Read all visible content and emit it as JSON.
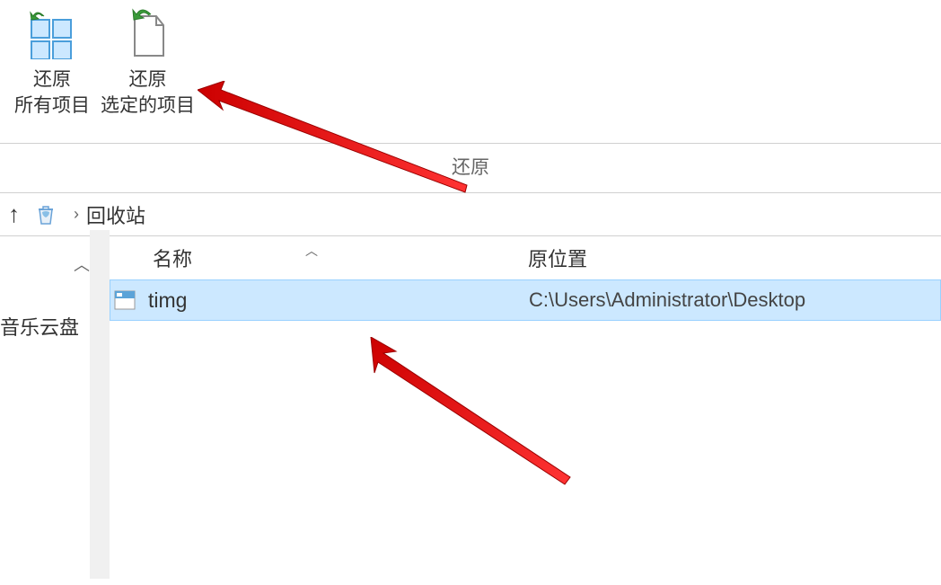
{
  "ribbon": {
    "restore_all": {
      "label_line1": "还原",
      "label_line2": "所有项目"
    },
    "restore_selected": {
      "label_line1": "还原",
      "label_line2": "选定的项目"
    },
    "group_label": "还原"
  },
  "breadcrumb": {
    "location": "回收站"
  },
  "sidebar": {
    "item": "音乐云盘"
  },
  "columns": {
    "name": "名称",
    "location": "原位置"
  },
  "files": [
    {
      "name": "timg",
      "location": "C:\\Users\\Administrator\\Desktop"
    }
  ]
}
